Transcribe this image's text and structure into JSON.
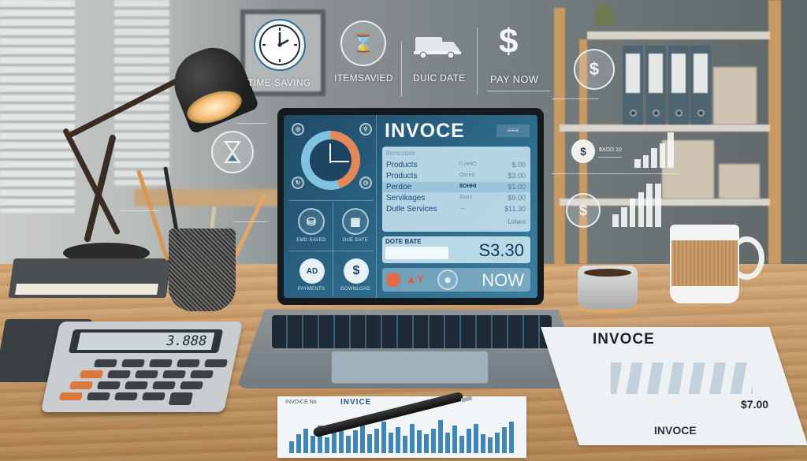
{
  "scene": {
    "description": "Desk workspace with laptop displaying an invoice app, floating holographic finance icons, calculator, coffee mugs and printed invoices"
  },
  "holo_header": {
    "items": [
      {
        "label": "TIME-SAVING",
        "icon": "clock-icon"
      },
      {
        "label": "ITEMSAVIED",
        "icon": "hourglass-coin-icon"
      },
      {
        "label": "DUIC DATE",
        "icon": "delivery-truck-icon"
      },
      {
        "label": "PAY NOW",
        "icon": "dollar-icon"
      }
    ]
  },
  "holo_side": {
    "dollar_symbol": "$",
    "hourglass_symbol": "⌛",
    "chart_a_bars": [
      0.25,
      0.35,
      0.55,
      0.7,
      1.0
    ],
    "chart_b_bars": [
      0.3,
      0.45,
      0.65,
      0.8,
      1.0,
      1.0
    ],
    "caption": "$XOD 10"
  },
  "laptop_screen": {
    "title": "INVOCE",
    "header_badge": "≡≡≡",
    "table": {
      "header": "Itemcodes",
      "rows": [
        {
          "name": "Products",
          "code": "0 HHO",
          "amount": "$.00"
        },
        {
          "name": "Products",
          "code": "Ooreo",
          "amount": "$3.00"
        },
        {
          "name": "Perdoe",
          "code": "8OHHI",
          "amount": "$1.00"
        },
        {
          "name": "Servikages",
          "code": "Sooo",
          "amount": "$9.00"
        },
        {
          "name": "Dutle Services",
          "code": "—",
          "amount": "$11.30"
        }
      ],
      "footer": "Lotaro"
    },
    "due_date_label": "DOTE BATE",
    "total_amount": "S3.30",
    "pay_button": "NOW",
    "left_panel": {
      "captions": [
        "EMD SAVED",
        "DUE DATE",
        "PAYMENTS",
        "DOWNLOAD"
      ],
      "dollar_symbol": "$",
      "ad_symbol": "AD"
    }
  },
  "calculator": {
    "display": "3.888"
  },
  "papers": {
    "right_title": "INVOCE",
    "right_amount": "$7.00",
    "right_footer": "INVOCE",
    "front_title": "INVICE",
    "front_header_left": "INVOICE No",
    "front_bars": [
      0.35,
      0.55,
      0.7,
      0.5,
      0.8,
      0.45,
      0.6,
      0.75,
      0.5,
      0.65,
      0.8,
      0.55,
      0.7,
      0.9,
      0.6,
      0.75,
      0.5,
      0.85,
      0.65,
      0.55,
      0.7,
      0.95,
      0.6,
      0.8,
      0.5,
      0.7,
      0.85,
      0.55,
      0.45,
      0.6,
      0.75,
      0.9
    ]
  },
  "colors": {
    "screen_accent": "#2a6384",
    "gauge_orange": "#e2885a",
    "gauge_blue": "#7fc3e0",
    "desk_wood": "#c9965e"
  }
}
